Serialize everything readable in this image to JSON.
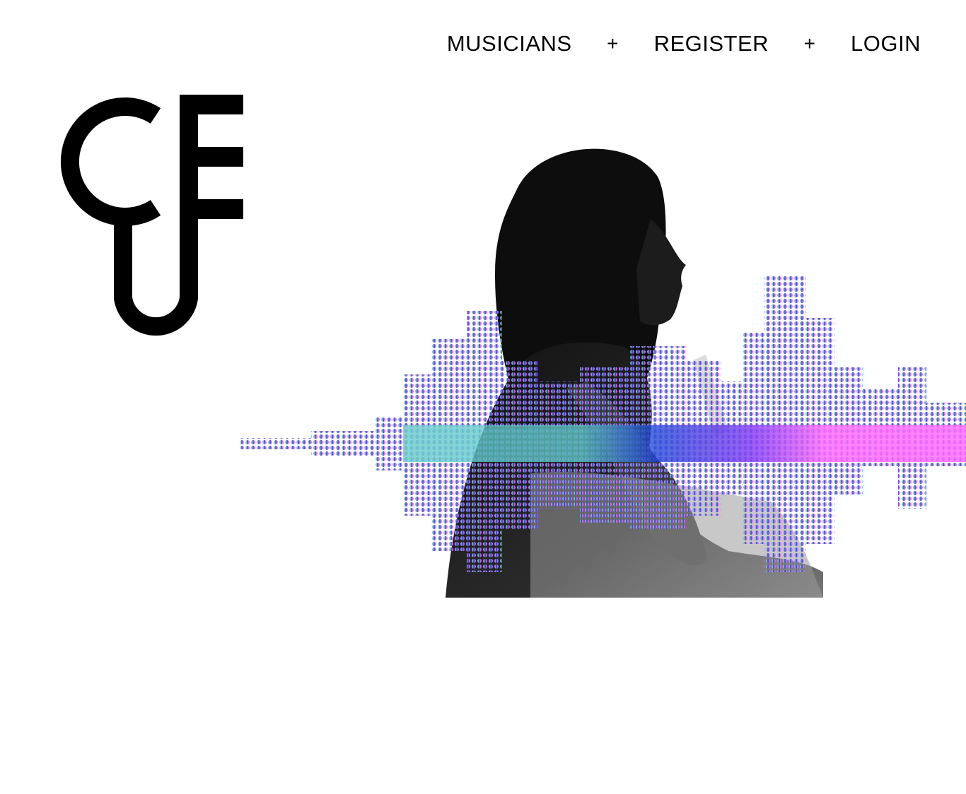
{
  "nav": {
    "items": [
      {
        "label": "MUSICIANS"
      },
      {
        "label": "REGISTER"
      },
      {
        "label": "LOGIN"
      }
    ],
    "separator": "+"
  },
  "logo": {
    "letters": "CFU",
    "color": "#000000"
  },
  "hero": {
    "icon": "musician-with-guitar-image",
    "waveform_colors": [
      "#5fc9c9",
      "#1a3fd6",
      "#7b2ff2",
      "#ff5cff"
    ]
  }
}
